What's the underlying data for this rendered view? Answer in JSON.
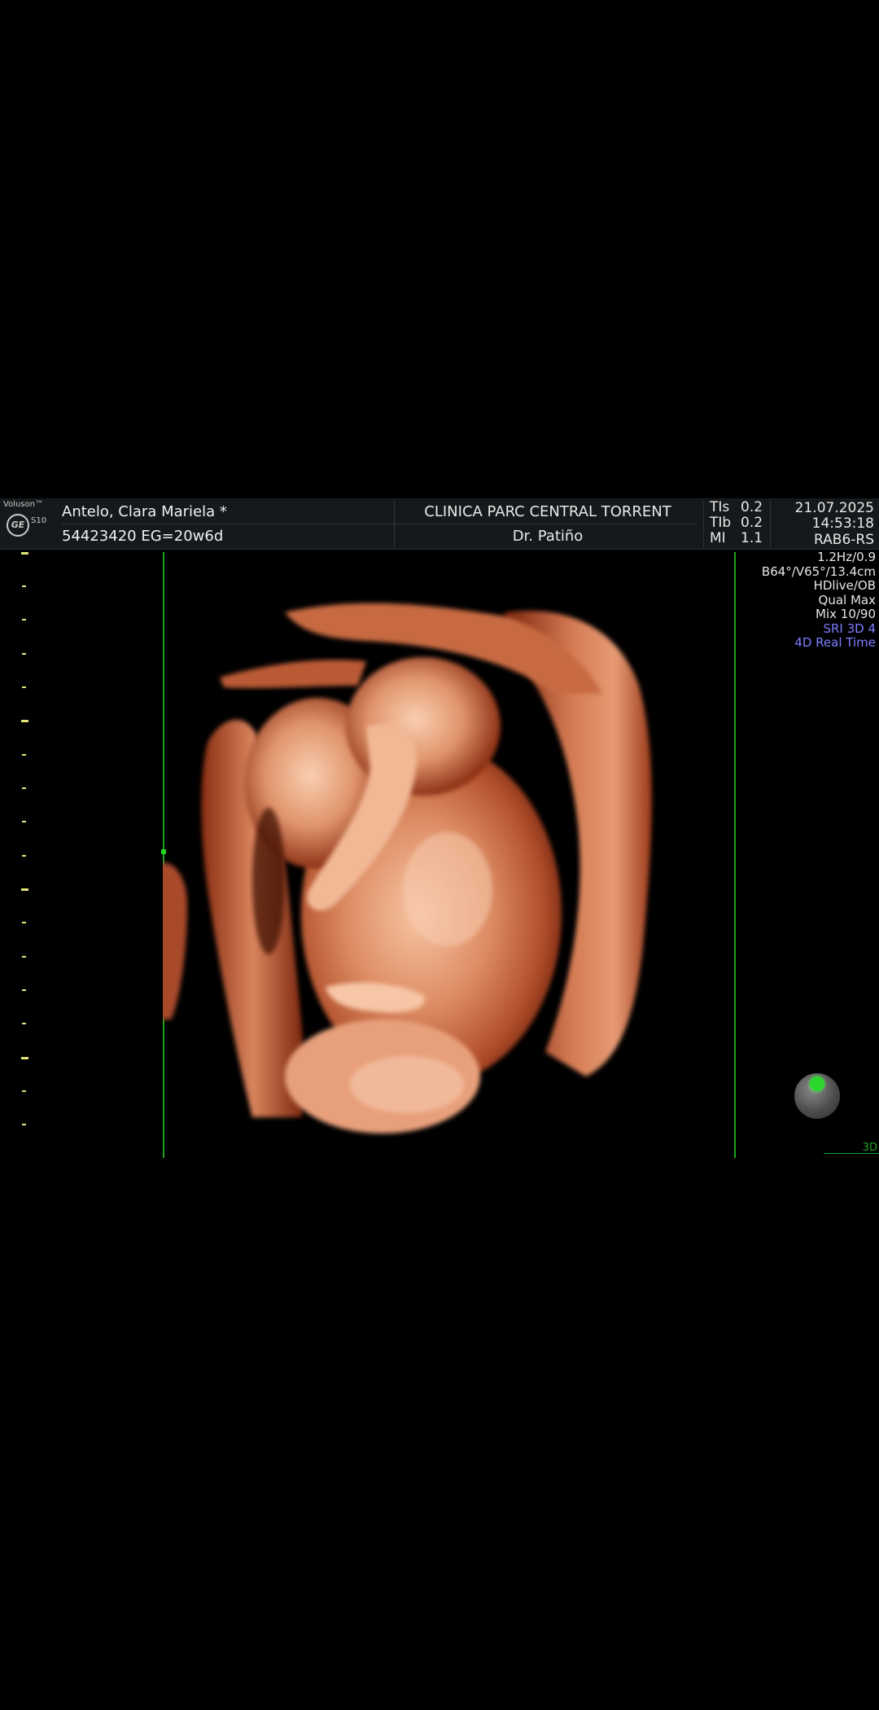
{
  "header": {
    "brand": "Voluson™",
    "logo_mark": "GE",
    "model": "S10",
    "patient_name": "Antelo, Clara Mariela  *",
    "patient_id": "54423420   EG=20w6d",
    "clinic": "CLINICA PARC CENTRAL TORRENT",
    "doctor": "Dr. Patiño",
    "params": [
      {
        "key": "TIs",
        "value": "0.2"
      },
      {
        "key": "TIb",
        "value": "0.2"
      },
      {
        "key": "MI",
        "value": "1.1"
      }
    ],
    "date": "21.07.2025",
    "time": "14:53:18",
    "probe": "RAB6-RS"
  },
  "info_panel": {
    "lines": [
      "1.2Hz/0.9",
      "B64°/V65°/13.4cm",
      "HDlive/OB",
      "Qual Max",
      "Mix 10/90"
    ],
    "mode_lines": [
      "SRI 3D 4",
      "4D Real Time"
    ]
  },
  "corner_label": "3D",
  "colors": {
    "background": "#000000",
    "header_bg": "#16191b",
    "roi_green": "#1ca31c",
    "scale_yellow": "#e3e37a",
    "mode_blue": "#7d7dff",
    "tissue_light": "#f1b08e",
    "tissue_dark": "#8a2a12"
  },
  "icons": [
    "ge-logo-icon",
    "orientation-sphere-icon"
  ]
}
